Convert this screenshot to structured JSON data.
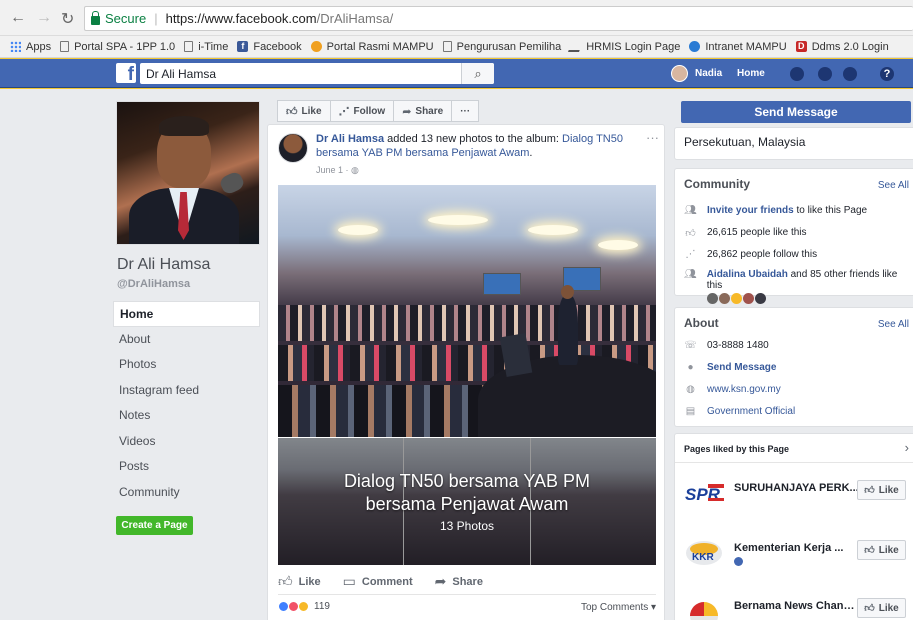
{
  "browser": {
    "secure_label": "Secure",
    "url_host": "https://www.facebook.com",
    "url_path": "/DrAliHamsa/",
    "bookmarks": [
      "Apps",
      "Portal SPA - 1PP 1.0",
      "i-Time",
      "Facebook",
      "Portal Rasmi MAMPU",
      "Pengurusan Pemiliha",
      "HRMIS Login Page",
      "Intranet MAMPU",
      "Ddms 2.0 Login"
    ]
  },
  "fb_header": {
    "logo": "f",
    "search_value": "Dr Ali Hamsa",
    "user_name": "Nadia",
    "home_label": "Home",
    "help_label": "?"
  },
  "page": {
    "name": "Dr Ali Hamsa",
    "handle": "@DrAliHamsa",
    "nav": [
      "Home",
      "About",
      "Photos",
      "Instagram feed",
      "Notes",
      "Videos",
      "Posts",
      "Community"
    ],
    "create_page_label": "Create a Page"
  },
  "actions": {
    "like": "Like",
    "follow": "Follow",
    "share": "Share",
    "more": "···"
  },
  "post": {
    "author": "Dr Ali Hamsa",
    "action_text": " added 13 new photos to the album: ",
    "album_link": "Dialog TN50 bersama YAB PM bersama Penjawat Awam",
    "period": ".",
    "date": "June 1 · ",
    "more": "···",
    "album_title": "Dialog TN50 bersama YAB PM bersama Penjawat Awam",
    "album_count": "13 Photos",
    "btn_like": "Like",
    "btn_comment": "Comment",
    "btn_share": "Share",
    "reaction_count": "119",
    "top_comments": "Top Comments ▾"
  },
  "right": {
    "send_message": "Send Message",
    "location": "Persekutuan, Malaysia",
    "community": {
      "title": "Community",
      "see_all": "See All",
      "invite_link": "Invite your friends",
      "invite_rest": " to like this Page",
      "likes": "26,615 people like this",
      "follows": "26,862 people follow this",
      "friend_link": "Aidalina Ubaidah",
      "friend_rest": " and 85 other friends like this"
    },
    "about": {
      "title": "About",
      "see_all": "See All",
      "phone": "03-8888 1480",
      "send_message": "Send Message",
      "website": "www.ksn.gov.my",
      "category": "Government Official"
    },
    "pages_liked": {
      "title": "Pages liked by this Page",
      "items": [
        {
          "name": "SURUHANJAYA PERK...",
          "like": "Like",
          "logo": "SPR"
        },
        {
          "name": "Kementerian Kerja ...",
          "like": "Like",
          "logo": "KKR"
        },
        {
          "name": "Bernama News Channel",
          "like": "Like",
          "logo": ""
        }
      ]
    }
  },
  "colors": {
    "fb_blue": "#4267b2",
    "link_blue": "#365899",
    "green": "#42b72a",
    "desktop_yellow": "#f3c833"
  }
}
